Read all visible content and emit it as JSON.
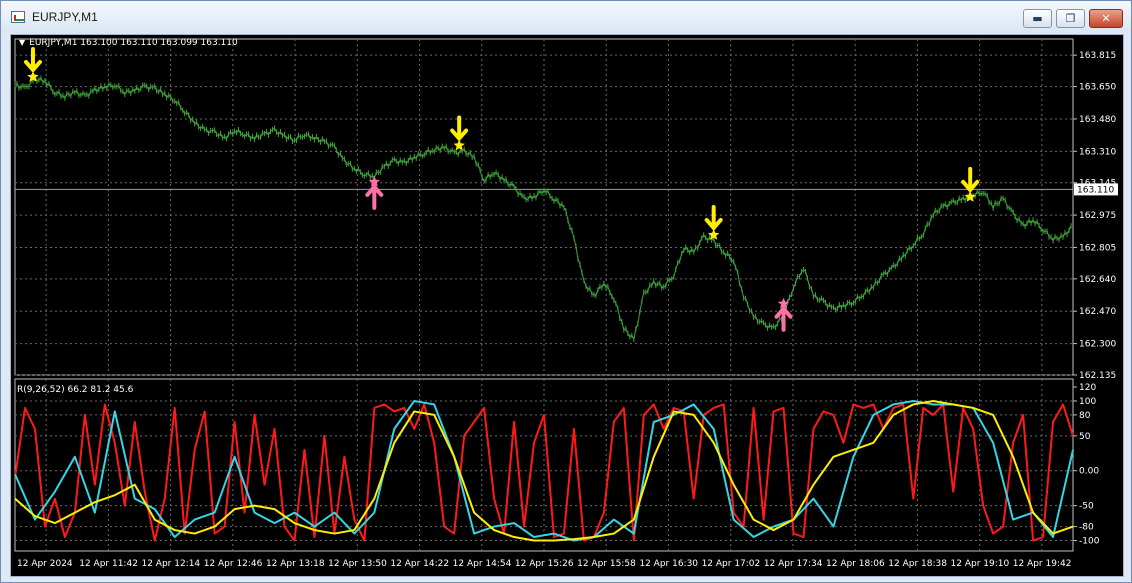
{
  "window": {
    "title": "EURJPY,M1",
    "minimize_glyph": "▬",
    "maximize_glyph": "❐",
    "close_glyph": "✕",
    "app_icon": "chart-window-icon"
  },
  "chart_info": "EURJPY,M1  163.100 163.110 163.099 163.110",
  "indicator_info": "R(9,26,52) 66.2 81.2 45.6",
  "current_price": "163.110",
  "colors": {
    "background": "#000000",
    "grid": "#6a6a6a",
    "price_line": "#3fa33a",
    "red_line": "#ff1a1a",
    "cyan_line": "#33d6e6",
    "yellow_line": "#ffee00",
    "sell_arrow": "#ffee00",
    "buy_arrow": "#ff6fa8",
    "current_price_bg": "#ffffff"
  },
  "chart_data": [
    {
      "type": "line",
      "series": [
        {
          "name": "",
          "x": [
            0,
            10,
            20,
            30,
            40,
            50,
            60,
            70,
            80,
            90,
            100,
            110,
            120,
            130,
            140,
            150,
            160,
            170,
            180,
            190,
            200,
            210,
            220,
            230,
            240,
            250,
            260,
            270,
            280,
            290,
            300,
            310,
            320,
            330,
            340,
            350,
            360,
            370,
            380,
            390,
            400,
            410,
            420,
            430,
            440,
            450,
            460,
            470,
            480,
            490,
            500,
            510,
            520,
            530,
            540,
            550,
            560,
            570,
            580,
            590,
            600,
            610,
            620,
            630,
            640,
            650,
            660,
            670,
            680,
            690,
            700,
            710,
            720,
            730,
            740,
            750,
            760,
            770,
            780,
            790,
            800,
            810,
            820,
            830,
            840,
            850,
            860,
            870,
            880,
            890,
            900,
            910,
            920,
            930,
            940,
            950,
            960,
            970,
            980,
            990,
            1000,
            1010,
            1020,
            1030,
            1040,
            1050,
            1060
          ],
          "values": [
            163.66,
            163.64,
            163.69,
            163.68,
            163.62,
            163.6,
            163.62,
            163.6,
            163.63,
            163.65,
            163.66,
            163.62,
            163.63,
            163.65,
            163.64,
            163.61,
            163.58,
            163.52,
            163.46,
            163.42,
            163.41,
            163.38,
            163.42,
            163.4,
            163.38,
            163.4,
            163.42,
            163.39,
            163.37,
            163.4,
            163.38,
            163.36,
            163.33,
            163.26,
            163.22,
            163.19,
            163.18,
            163.23,
            163.26,
            163.25,
            163.28,
            163.3,
            163.32,
            163.33,
            163.3,
            163.31,
            163.28,
            163.16,
            163.2,
            163.16,
            163.12,
            163.06,
            163.07,
            163.11,
            163.06,
            163.02,
            162.85,
            162.62,
            162.55,
            162.62,
            162.54,
            162.38,
            162.32,
            162.56,
            162.62,
            162.6,
            162.66,
            162.8,
            162.78,
            162.86,
            162.84,
            162.78,
            162.74,
            162.55,
            162.44,
            162.4,
            162.38,
            162.45,
            162.6,
            162.7,
            162.55,
            162.52,
            162.48,
            162.5,
            162.52,
            162.56,
            162.6,
            162.66,
            162.7,
            162.76,
            162.82,
            162.88,
            162.98,
            163.02,
            163.04,
            163.06,
            163.08,
            163.1,
            163.02,
            163.06,
            162.98,
            162.92,
            162.95,
            162.9,
            162.85,
            162.86,
            162.92
          ]
        }
      ],
      "ylim": [
        162.135,
        163.9
      ],
      "y_ticks": [
        "163.815",
        "163.650",
        "163.480",
        "163.310",
        "163.145",
        "162.975",
        "162.805",
        "162.640",
        "162.470",
        "162.300",
        "162.135"
      ],
      "x_ticks": [
        "12 Apr 2024",
        "12 Apr 11:42",
        "12 Apr 12:14",
        "12 Apr 12:46",
        "12 Apr 13:18",
        "12 Apr 13:50",
        "12 Apr 14:22",
        "12 Apr 14:54",
        "12 Apr 15:26",
        "12 Apr 15:58",
        "12 Apr 16:30",
        "12 Apr 17:02",
        "12 Apr 17:34",
        "12 Apr 18:06",
        "12 Apr 18:38",
        "12 Apr 19:10",
        "12 Apr 19:42"
      ],
      "current_price": 163.11,
      "sell_signals": [
        {
          "x": 18,
          "value": 163.69
        },
        {
          "x": 445,
          "value": 163.33
        },
        {
          "x": 700,
          "value": 162.86
        },
        {
          "x": 957,
          "value": 163.06
        }
      ],
      "buy_signals": [
        {
          "x": 360,
          "value": 163.16
        },
        {
          "x": 770,
          "value": 162.52
        }
      ],
      "grid": true
    },
    {
      "type": "line",
      "ylim": [
        -115,
        120
      ],
      "y_ticks": [
        "120",
        "100",
        "80",
        "50",
        "0.00",
        "-50",
        "-80",
        "-100"
      ],
      "grid": true,
      "series": [
        {
          "name": "",
          "x": [
            0,
            10,
            20,
            30,
            40,
            50,
            60,
            70,
            80,
            90,
            100,
            110,
            120,
            130,
            140,
            150,
            160,
            170,
            180,
            190,
            200,
            210,
            220,
            230,
            240,
            250,
            260,
            270,
            280,
            290,
            300,
            310,
            320,
            330,
            340,
            350,
            360,
            370,
            380,
            390,
            400,
            410,
            420,
            430,
            440,
            450,
            460,
            470,
            480,
            490,
            500,
            510,
            520,
            530,
            540,
            550,
            560,
            570,
            580,
            590,
            600,
            610,
            620,
            630,
            640,
            650,
            660,
            670,
            680,
            690,
            700,
            710,
            720,
            730,
            740,
            750,
            760,
            770,
            780,
            790,
            800,
            810,
            820,
            830,
            840,
            850,
            860,
            870,
            880,
            890,
            900,
            910,
            920,
            930,
            940,
            950,
            960,
            970,
            980,
            990,
            1000,
            1010,
            1020,
            1030,
            1040,
            1050,
            1060
          ],
          "values": [
            -10,
            90,
            60,
            -80,
            -40,
            -95,
            -60,
            80,
            -20,
            95,
            40,
            -50,
            70,
            -30,
            -100,
            -40,
            90,
            -90,
            30,
            85,
            -90,
            -80,
            70,
            -60,
            80,
            -20,
            60,
            -80,
            -100,
            30,
            -95,
            50,
            -90,
            20,
            -70,
            -100,
            90,
            95,
            85,
            90,
            60,
            95,
            40,
            -80,
            -90,
            50,
            70,
            90,
            -40,
            -90,
            70,
            -80,
            40,
            80,
            -95,
            -90,
            60,
            -100,
            -95,
            -60,
            70,
            90,
            -100,
            80,
            95,
            60,
            90,
            85,
            -40,
            80,
            90,
            95,
            -60,
            -80,
            90,
            -70,
            85,
            90,
            -90,
            -95,
            60,
            85,
            80,
            40,
            95,
            90,
            95,
            60,
            90,
            95,
            -40,
            90,
            80,
            95,
            -30,
            90,
            60,
            -50,
            -90,
            -80,
            40,
            80,
            -100,
            -95,
            70,
            95,
            50
          ],
          "color_key": "red_line"
        },
        {
          "name": "",
          "x": [
            0,
            20,
            40,
            60,
            80,
            100,
            120,
            140,
            160,
            180,
            200,
            220,
            240,
            260,
            280,
            300,
            320,
            340,
            360,
            380,
            400,
            420,
            440,
            460,
            480,
            500,
            520,
            540,
            560,
            580,
            600,
            620,
            640,
            660,
            680,
            700,
            720,
            740,
            760,
            780,
            800,
            820,
            840,
            860,
            880,
            900,
            920,
            940,
            960,
            980,
            1000,
            1020,
            1040,
            1060
          ],
          "values": [
            -5,
            -70,
            -30,
            20,
            -60,
            85,
            -40,
            -55,
            -95,
            -70,
            -60,
            20,
            -60,
            -75,
            -60,
            -80,
            -60,
            -90,
            -60,
            60,
            100,
            95,
            20,
            -90,
            -80,
            -75,
            -95,
            -90,
            -100,
            -95,
            -70,
            -90,
            70,
            80,
            95,
            60,
            -70,
            -95,
            -80,
            -70,
            -40,
            -80,
            20,
            80,
            95,
            100,
            95,
            95,
            90,
            40,
            -70,
            -60,
            -95,
            30
          ],
          "color_key": "cyan_line"
        },
        {
          "name": "",
          "x": [
            0,
            20,
            40,
            60,
            80,
            100,
            120,
            140,
            160,
            180,
            200,
            220,
            240,
            260,
            280,
            300,
            320,
            340,
            360,
            380,
            400,
            420,
            440,
            460,
            480,
            500,
            520,
            540,
            560,
            580,
            600,
            620,
            640,
            660,
            680,
            700,
            720,
            740,
            760,
            780,
            800,
            820,
            840,
            860,
            880,
            900,
            920,
            940,
            960,
            980,
            1000,
            1020,
            1040,
            1060
          ],
          "values": [
            -40,
            -65,
            -75,
            -60,
            -45,
            -35,
            -20,
            -70,
            -85,
            -90,
            -80,
            -55,
            -50,
            -55,
            -75,
            -85,
            -90,
            -85,
            -40,
            40,
            85,
            80,
            20,
            -60,
            -85,
            -95,
            -100,
            -100,
            -98,
            -95,
            -90,
            -70,
            20,
            85,
            80,
            40,
            -20,
            -70,
            -85,
            -70,
            -20,
            20,
            30,
            40,
            80,
            95,
            100,
            95,
            90,
            80,
            20,
            -60,
            -90,
            -80
          ],
          "color_key": "yellow_line"
        }
      ]
    }
  ]
}
